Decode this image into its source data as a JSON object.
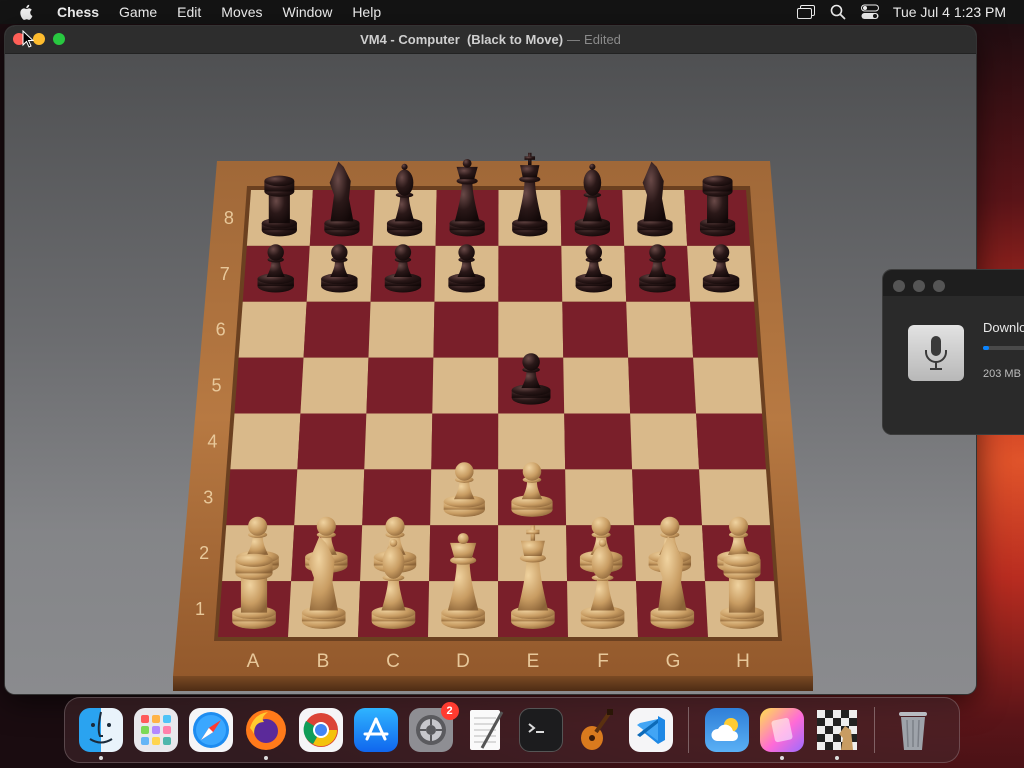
{
  "menubar": {
    "app_name": "Chess",
    "menus": [
      "Game",
      "Edit",
      "Moves",
      "Window",
      "Help"
    ],
    "status_icons": [
      "screen-mirroring-icon",
      "spotlight-search-icon",
      "control-center-icon"
    ],
    "clock": "Tue Jul 4  1:23 PM"
  },
  "chess_window": {
    "title": "VM4 - Computer  (Black to Move)",
    "separator": "—",
    "edited": "Edited",
    "board": {
      "ranks": [
        "8",
        "7",
        "6",
        "5",
        "4",
        "3",
        "2",
        "1"
      ],
      "files": [
        "A",
        "B",
        "C",
        "D",
        "E",
        "F",
        "G",
        "H"
      ],
      "colors": {
        "light_square": "#d9b98a",
        "dark_square": "#7a1f2a",
        "frame": "#9b6435",
        "white_piece": "#c8a06a",
        "black_piece": "#2a1a1a"
      },
      "pieces": [
        {
          "square": "a8",
          "color": "black",
          "type": "rook"
        },
        {
          "square": "b8",
          "color": "black",
          "type": "knight"
        },
        {
          "square": "c8",
          "color": "black",
          "type": "bishop"
        },
        {
          "square": "d8",
          "color": "black",
          "type": "queen"
        },
        {
          "square": "e8",
          "color": "black",
          "type": "king"
        },
        {
          "square": "f8",
          "color": "black",
          "type": "bishop"
        },
        {
          "square": "g8",
          "color": "black",
          "type": "knight"
        },
        {
          "square": "h8",
          "color": "black",
          "type": "rook"
        },
        {
          "square": "a7",
          "color": "black",
          "type": "pawn"
        },
        {
          "square": "b7",
          "color": "black",
          "type": "pawn"
        },
        {
          "square": "c7",
          "color": "black",
          "type": "pawn"
        },
        {
          "square": "d7",
          "color": "black",
          "type": "pawn"
        },
        {
          "square": "f7",
          "color": "black",
          "type": "pawn"
        },
        {
          "square": "g7",
          "color": "black",
          "type": "pawn"
        },
        {
          "square": "h7",
          "color": "black",
          "type": "pawn"
        },
        {
          "square": "e5",
          "color": "black",
          "type": "pawn"
        },
        {
          "square": "d3",
          "color": "white",
          "type": "pawn"
        },
        {
          "square": "e3",
          "color": "white",
          "type": "pawn"
        },
        {
          "square": "a2",
          "color": "white",
          "type": "pawn"
        },
        {
          "square": "b2",
          "color": "white",
          "type": "pawn"
        },
        {
          "square": "c2",
          "color": "white",
          "type": "pawn"
        },
        {
          "square": "f2",
          "color": "white",
          "type": "pawn"
        },
        {
          "square": "g2",
          "color": "white",
          "type": "pawn"
        },
        {
          "square": "h2",
          "color": "white",
          "type": "pawn"
        },
        {
          "square": "a1",
          "color": "white",
          "type": "rook"
        },
        {
          "square": "b1",
          "color": "white",
          "type": "knight"
        },
        {
          "square": "c1",
          "color": "white",
          "type": "bishop"
        },
        {
          "square": "d1",
          "color": "white",
          "type": "queen"
        },
        {
          "square": "e1",
          "color": "white",
          "type": "king"
        },
        {
          "square": "f1",
          "color": "white",
          "type": "bishop"
        },
        {
          "square": "g1",
          "color": "white",
          "type": "knight"
        },
        {
          "square": "h1",
          "color": "white",
          "type": "rook"
        }
      ]
    }
  },
  "download_panel": {
    "title": "Downlo",
    "size": "203 MB",
    "progress": 0.1,
    "icon": "microphone-icon"
  },
  "dock": {
    "items": [
      {
        "name": "finder",
        "icon": "finder-icon",
        "running": true
      },
      {
        "name": "launchpad",
        "icon": "launchpad-icon",
        "running": false
      },
      {
        "name": "safari",
        "icon": "safari-icon",
        "running": false
      },
      {
        "name": "firefox",
        "icon": "firefox-icon",
        "running": true
      },
      {
        "name": "chrome",
        "icon": "chrome-icon",
        "running": false
      },
      {
        "name": "app-store",
        "icon": "app-store-icon",
        "running": false
      },
      {
        "name": "system-settings",
        "icon": "system-settings-icon",
        "running": false,
        "badge": "2"
      },
      {
        "name": "textedit",
        "icon": "textedit-icon",
        "running": false
      },
      {
        "name": "terminal",
        "icon": "terminal-icon",
        "running": false
      },
      {
        "name": "garageband",
        "icon": "garageband-icon",
        "running": false
      },
      {
        "name": "vscode",
        "icon": "vscode-icon",
        "running": false
      },
      {
        "name": "weather",
        "icon": "weather-icon",
        "running": false
      },
      {
        "name": "notes-gradient",
        "icon": "gradient-app-icon",
        "running": true
      },
      {
        "name": "chess",
        "icon": "chess-icon",
        "running": true
      },
      {
        "name": "trash",
        "icon": "trash-icon",
        "running": false
      }
    ]
  }
}
